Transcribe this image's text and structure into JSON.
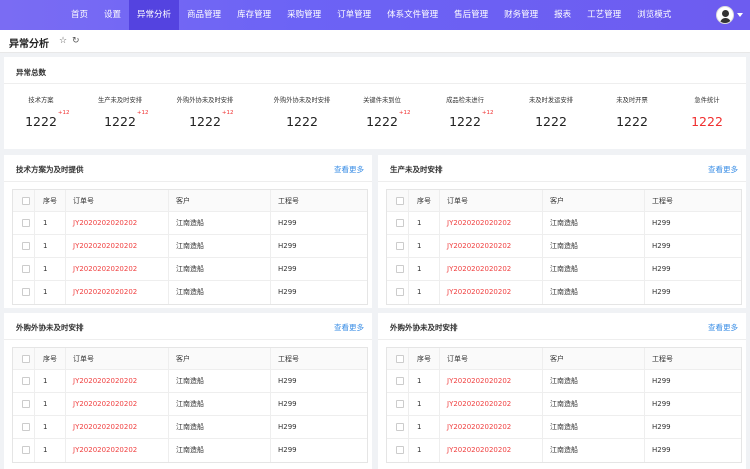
{
  "nav": {
    "items": [
      "首页",
      "设置",
      "异常分析",
      "商品管理",
      "库存管理",
      "采购管理",
      "订单管理",
      "体系文件管理",
      "售后管理",
      "财务管理",
      "报表",
      "工艺管理",
      "浏览模式"
    ],
    "active_index": 2,
    "colors": {
      "bar": "#6c63f5",
      "active": "#5443e0"
    }
  },
  "page": {
    "title": "异常分析",
    "star_icon": "star-icon",
    "refresh_icon": "refresh-icon"
  },
  "summary": {
    "title": "异常总数",
    "stats": [
      {
        "label": "技术方案",
        "value": "1222",
        "delta": "+12",
        "red": false
      },
      {
        "label": "生产未及时安排",
        "value": "1222",
        "delta": "+12",
        "red": false
      },
      {
        "label": "外购外协未及时安排",
        "value": "1222",
        "delta": "+12",
        "red": false
      },
      {
        "label": "外购外协未及时安排",
        "value": "1222",
        "delta": "",
        "red": false
      },
      {
        "label": "关键件未到位",
        "value": "1222",
        "delta": "+12",
        "red": false
      },
      {
        "label": "成品检未进行",
        "value": "1222",
        "delta": "+12",
        "red": false
      },
      {
        "label": "未及时发运安排",
        "value": "1222",
        "delta": "",
        "red": false
      },
      {
        "label": "未及时开票",
        "value": "1222",
        "delta": "",
        "red": false
      },
      {
        "label": "急件统计",
        "value": "1222",
        "delta": "",
        "red": true
      }
    ]
  },
  "panels": [
    {
      "title": "技术方案为及时提供",
      "more": "查看更多"
    },
    {
      "title": "生产未及时安排",
      "more": "查看更多"
    },
    {
      "title": "外购外协未及时安排",
      "more": "查看更多"
    },
    {
      "title": "外购外协未及时安排",
      "more": "查看更多"
    }
  ],
  "table": {
    "headers": [
      "序号",
      "订单号",
      "客户",
      "工程号"
    ],
    "rows": [
      [
        "1",
        "JY2020202020202",
        "江南造船",
        "H299"
      ],
      [
        "1",
        "JY2020202020202",
        "江南造船",
        "H299"
      ],
      [
        "1",
        "JY2020202020202",
        "江南造船",
        "H299"
      ],
      [
        "1",
        "JY2020202020202",
        "江南造船",
        "H299"
      ]
    ]
  }
}
